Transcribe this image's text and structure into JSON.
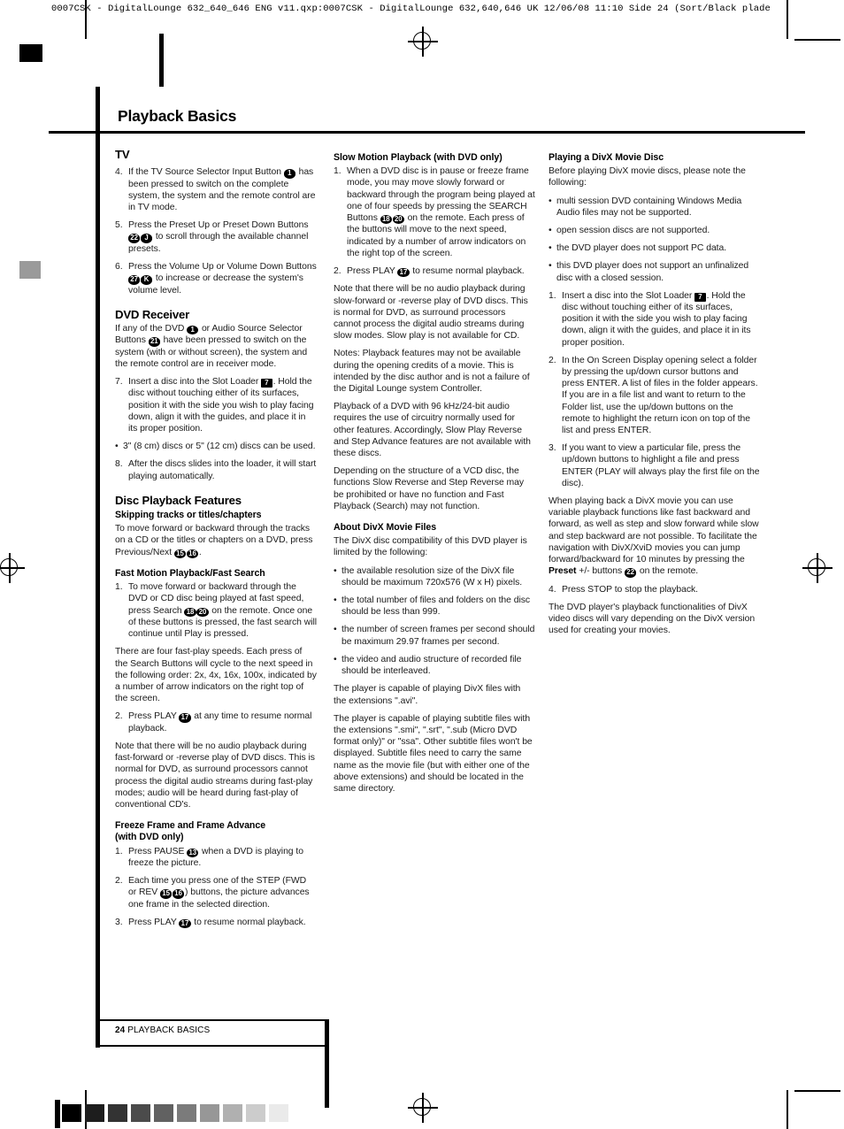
{
  "print_marks": {
    "slug_line": "0007CSK - DigitalLounge 632_640_646 ENG v11.qxp:0007CSK - DigitalLounge 632,640,646 UK  12/06/08  11:10  Side 24    (Sort/Black plade",
    "wedge_steps": [
      "#000000",
      "#1d1d1d",
      "#333333",
      "#4b4b4b",
      "#616161",
      "#7b7b7b",
      "#979797",
      "#b0b0b0",
      "#cccccc",
      "#eaeaea"
    ]
  },
  "page": {
    "title": "Playback Basics",
    "footer_page_number": "24",
    "footer_label": "PLAYBACK BASICS"
  },
  "col1": {
    "tv": {
      "heading": "TV",
      "steps": [
        {
          "num": "4.",
          "parts": [
            {
              "t": "text",
              "v": "If the TV Source Selector Input Button "
            },
            {
              "t": "badge",
              "v": "1",
              "shape": "circle"
            },
            {
              "t": "text",
              "v": " has been pressed to switch on the complete system, the system and the remote control are in TV mode."
            }
          ]
        },
        {
          "num": "5.",
          "parts": [
            {
              "t": "text",
              "v": "Press the Preset Up or Preset Down Buttons "
            },
            {
              "t": "badge",
              "v": "22",
              "shape": "circle"
            },
            {
              "t": "badge",
              "v": "J",
              "shape": "circle"
            },
            {
              "t": "text",
              "v": " to scroll through the available channel presets."
            }
          ]
        },
        {
          "num": "6.",
          "parts": [
            {
              "t": "text",
              "v": "Press the Volume Up or Volume Down Buttons "
            },
            {
              "t": "badge",
              "v": "27",
              "shape": "circle"
            },
            {
              "t": "badge",
              "v": "K",
              "shape": "circle"
            },
            {
              "t": "text",
              "v": " to increase or decrease the system's volume level."
            }
          ]
        }
      ]
    },
    "dvd_receiver": {
      "heading": "DVD Receiver",
      "intro": [
        {
          "t": "text",
          "v": "If any of the DVD "
        },
        {
          "t": "badge",
          "v": "1",
          "shape": "circle"
        },
        {
          "t": "text",
          "v": " or Audio Source Selector Buttons "
        },
        {
          "t": "badge",
          "v": "21",
          "shape": "circle"
        },
        {
          "t": "text",
          "v": " have been pressed to switch on the system (with or without screen), the system and the remote control are in receiver mode."
        }
      ],
      "steps": [
        {
          "num": "7.",
          "parts": [
            {
              "t": "text",
              "v": "Insert a disc into the Slot Loader "
            },
            {
              "t": "badge",
              "v": "7",
              "shape": "square"
            },
            {
              "t": "text",
              "v": ". Hold the disc without touching either of its surfaces, position it with the side you wish to play facing down, align it with the guides, and place it in its proper position."
            }
          ]
        }
      ],
      "bullet": "3\" (8 cm) discs or 5\" (12 cm) discs can be used.",
      "step8": {
        "num": "8.",
        "text": "After the discs slides into the loader, it will start playing automatically."
      }
    },
    "disc_features": {
      "heading": "Disc Playback Features",
      "skipping": {
        "sub": "Skipping tracks or titles/chapters",
        "parts": [
          {
            "t": "text",
            "v": "To move forward or backward through the tracks on a CD or the titles or chapters on a DVD, press Previous/Next "
          },
          {
            "t": "badge",
            "v": "15",
            "shape": "circle"
          },
          {
            "t": "badge",
            "v": "16",
            "shape": "circle"
          },
          {
            "t": "text",
            "v": "."
          }
        ]
      },
      "fast": {
        "sub": "Fast Motion Playback/Fast Search",
        "step1": {
          "num": "1.",
          "parts": [
            {
              "t": "text",
              "v": "To move forward or backward through the DVD or CD disc being played at fast speed, press Search "
            },
            {
              "t": "badge",
              "v": "18",
              "shape": "circle"
            },
            {
              "t": "badge",
              "v": "20",
              "shape": "circle"
            },
            {
              "t": "text",
              "v": " on the remote. Once one of these buttons is pressed, the fast search will continue until Play is pressed."
            }
          ]
        },
        "para1": "There are four fast-play speeds. Each press of the Search Buttons will cycle to the next speed in the following order: 2x, 4x, 16x, 100x, indicated by a number of arrow indicators on the right top of the screen.",
        "step2": {
          "num": "2.",
          "parts": [
            {
              "t": "text",
              "v": "Press PLAY "
            },
            {
              "t": "badge",
              "v": "17",
              "shape": "circle"
            },
            {
              "t": "text",
              "v": " at any time to resume normal playback."
            }
          ]
        },
        "para2": "Note that there will be no audio playback during fast-forward or -reverse play of DVD discs. This is normal for DVD, as surround processors cannot process the digital audio streams during fast-play modes; audio will be heard during fast-play of conventional CD's."
      },
      "freeze": {
        "sub_line1": "Freeze Frame and Frame Advance",
        "sub_line2": "(with DVD only)",
        "steps": [
          {
            "num": "1.",
            "parts": [
              {
                "t": "text",
                "v": "Press PAUSE "
              },
              {
                "t": "badge",
                "v": "13",
                "shape": "circle"
              },
              {
                "t": "text",
                "v": " when a DVD is playing to freeze the picture."
              }
            ]
          },
          {
            "num": "2.",
            "parts": [
              {
                "t": "text",
                "v": "Each time you press one of the STEP (FWD or REV "
              },
              {
                "t": "badge",
                "v": "15",
                "shape": "circle"
              },
              {
                "t": "badge",
                "v": "16",
                "shape": "circle"
              },
              {
                "t": "text",
                "v": ") buttons, the picture advances one frame in the selected direction."
              }
            ]
          },
          {
            "num": "3.",
            "parts": [
              {
                "t": "text",
                "v": "Press PLAY "
              },
              {
                "t": "badge",
                "v": "17",
                "shape": "circle"
              },
              {
                "t": "text",
                "v": " to resume normal playback."
              }
            ]
          }
        ]
      }
    }
  },
  "col2": {
    "slow": {
      "sub": "Slow Motion Playback (with DVD only)",
      "step1": {
        "num": "1.",
        "parts": [
          {
            "t": "text",
            "v": "When a DVD disc is in pause or freeze frame mode, you may move slowly forward or backward through the program being played at one of four speeds by pressing the SEARCH Buttons "
          },
          {
            "t": "badge",
            "v": "18",
            "shape": "circle"
          },
          {
            "t": "badge",
            "v": "20",
            "shape": "circle"
          },
          {
            "t": "text",
            "v": " on the remote. Each press of the buttons will move to the next speed, indicated by a number of arrow indicators on the right top of the screen."
          }
        ]
      },
      "step2": {
        "num": "2.",
        "parts": [
          {
            "t": "text",
            "v": "Press PLAY "
          },
          {
            "t": "badge",
            "v": "17",
            "shape": "circle"
          },
          {
            "t": "text",
            "v": " to resume normal playback."
          }
        ]
      },
      "para1": "Note that there will be no audio playback during slow-forward or -reverse play of DVD discs. This is normal for DVD, as surround processors cannot process the digital audio streams during slow modes. Slow play is not available for CD.",
      "para2": "Notes: Playback features may not be available during the opening credits of a movie. This is intended by the disc author and is not a failure of the Digital Lounge system Controller.",
      "para3": "Playback of a DVD with 96 kHz/24-bit audio requires the use of circuitry normally used for other features. Accordingly, Slow Play Reverse and Step Advance features are not available with these discs.",
      "para4": "Depending on the structure of a VCD disc, the functions Slow Reverse and Step Reverse may be prohibited or have no function and Fast Playback (Search) may not function."
    },
    "divx": {
      "sub": "About DivX Movie Files",
      "intro": "The DivX disc compatibility of this DVD player is limited by the following:",
      "bullets": [
        "the available resolution size of the DivX file should be maximum 720x576 (W x H) pixels.",
        "the total number of files and folders on the disc should be less than 999.",
        "the number of screen frames per second should be maximum 29.97 frames per second.",
        "the video and audio structure of recorded file should be interleaved."
      ],
      "para1": "The player is capable of playing DivX files with the extensions \".avi\".",
      "para2": "The player is capable of playing subtitle files with the extensions \".smi\", \".srt\", \".sub (Micro DVD format only)\" or \"ssa\". Other subtitle files won't be displayed. Subtitle files need to carry the same name as the movie file (but with either one of the above extensions) and should be located in the same directory."
    }
  },
  "col3": {
    "playing": {
      "sub": "Playing a DivX Movie Disc",
      "intro": "Before playing DivX movie discs, please note the following:",
      "bullets": [
        "multi session DVD containing Windows Media Audio files may not be supported.",
        "open session discs are not supported.",
        "the DVD player does not support PC data.",
        "this DVD player does not support an unfinalized disc with a closed session."
      ],
      "steps": [
        {
          "num": "1.",
          "parts": [
            {
              "t": "text",
              "v": "Insert a disc into the Slot Loader "
            },
            {
              "t": "badge",
              "v": "7",
              "shape": "square"
            },
            {
              "t": "text",
              "v": ". Hold the disc without touching either of its surfaces, position it with the side you wish to play facing down, align it with the guides, and place it in its proper position."
            }
          ]
        },
        {
          "num": "2.",
          "parts": [
            {
              "t": "text",
              "v": "In the On Screen Display opening select a folder by pressing the up/down cursor buttons and press ENTER. A list of files in the folder appears. If you are in a file list and want to return to the Folder list, use the up/down buttons on the remote to highlight the return icon on top of the list and press ENTER."
            }
          ]
        },
        {
          "num": "3.",
          "parts": [
            {
              "t": "text",
              "v": "If you want to view a particular file, press the up/down buttons to highlight a file and press ENTER (PLAY will always play the first file on the disc)."
            }
          ]
        }
      ],
      "para1": [
        {
          "t": "text",
          "v": "When playing back a DivX movie you can use variable playback functions like fast backward and forward, as well as step and slow forward while slow and step backward are not possible. To facilitate the navigation with DivX/XviD movies you  can jump forward/backward for 10 minutes by pressing the "
        },
        {
          "t": "bold",
          "v": "Preset"
        },
        {
          "t": "text",
          "v": " +/- buttons "
        },
        {
          "t": "badge",
          "v": "22",
          "shape": "circle"
        },
        {
          "t": "text",
          "v": " on the remote."
        }
      ],
      "step4": {
        "num": "4.",
        "text": "Press STOP to stop the playback."
      },
      "para2": "The DVD player's playback functionalities of DivX video discs will vary depending on the DivX version used for creating your movies."
    }
  }
}
